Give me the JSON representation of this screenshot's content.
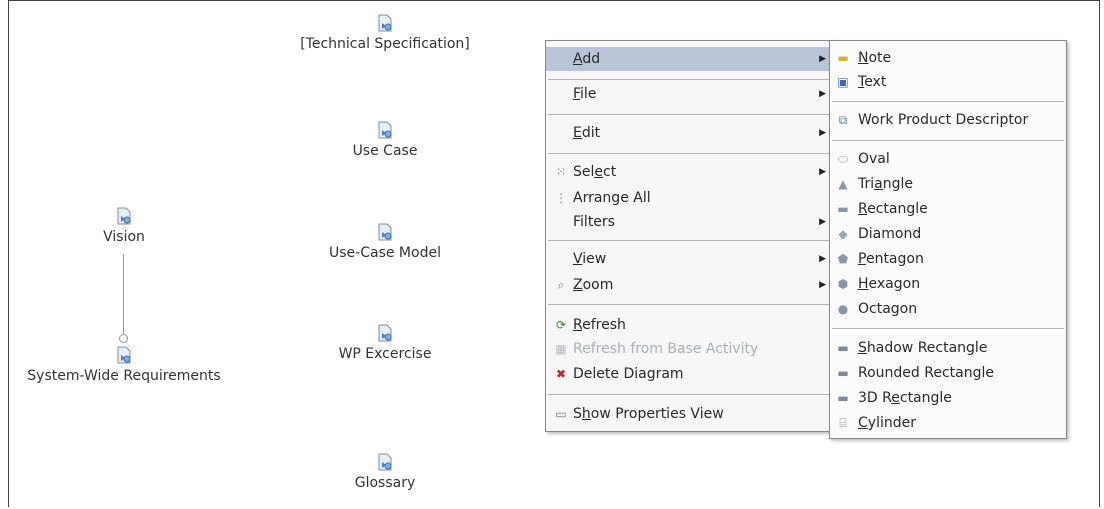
{
  "diagram": {
    "nodes": [
      {
        "id": "technical-spec",
        "label": "[Technical Specification]"
      },
      {
        "id": "use-case",
        "label": "Use Case"
      },
      {
        "id": "use-case-model",
        "label": "Use-Case Model"
      },
      {
        "id": "wp-excercise",
        "label": "WP Excercise"
      },
      {
        "id": "glossary",
        "label": "Glossary"
      },
      {
        "id": "vision",
        "label": "Vision"
      },
      {
        "id": "system-wide",
        "label": "System-Wide Requirements"
      }
    ]
  },
  "context_menu": {
    "items": [
      {
        "label": "Add",
        "mnemonic": "A",
        "rest": "dd",
        "submenu": true,
        "highlighted": true
      },
      {
        "label": "File",
        "mnemonic": "F",
        "rest": "ile",
        "submenu": true
      },
      {
        "label": "Edit",
        "mnemonic": "E",
        "rest": "dit",
        "submenu": true
      },
      {
        "label": "Select",
        "pre": "Sel",
        "mnemonic": "e",
        "rest": "ct",
        "submenu": true,
        "icon": "select-icon"
      },
      {
        "label": "Arrange All",
        "pre": "Arran",
        "mnemonic": "g",
        "rest": "e All",
        "icon": "arrange-icon"
      },
      {
        "label": "Filters",
        "submenu": true
      },
      {
        "label": "View",
        "mnemonic": "V",
        "rest": "iew",
        "submenu": true
      },
      {
        "label": "Zoom",
        "mnemonic": "Z",
        "rest": "oom",
        "submenu": true,
        "icon": "zoom-icon"
      },
      {
        "label": "Refresh",
        "mnemonic": "R",
        "rest": "efresh",
        "icon": "refresh-icon"
      },
      {
        "label": "Refresh from Base Activity",
        "disabled": true,
        "icon": "refresh-base-icon"
      },
      {
        "label": "Delete Diagram",
        "icon": "delete-icon",
        "icon_color": "#cc2222"
      },
      {
        "label": "Show Properties View",
        "pre": "S",
        "mnemonic": "h",
        "rest": "ow Properties View",
        "icon": "properties-icon"
      }
    ]
  },
  "add_submenu": {
    "items": [
      {
        "label": "Note",
        "mnemonic": "N",
        "rest": "ote",
        "icon": "note-icon"
      },
      {
        "label": "Text",
        "mnemonic": "T",
        "rest": "ext",
        "icon": "text-icon"
      },
      {
        "label": "Work Product Descriptor",
        "icon": "work-product-icon"
      },
      {
        "label": "Oval",
        "icon": "oval-icon"
      },
      {
        "label": "Triangle",
        "pre": "Tri",
        "mnemonic": "a",
        "rest": "ngle",
        "icon": "triangle-icon"
      },
      {
        "label": "Rectangle",
        "mnemonic": "R",
        "rest": "ectangle",
        "icon": "rectangle-icon"
      },
      {
        "label": "Diamond",
        "icon": "diamond-icon"
      },
      {
        "label": "Pentagon",
        "mnemonic": "P",
        "rest": "entagon",
        "icon": "pentagon-icon"
      },
      {
        "label": "Hexagon",
        "mnemonic": "H",
        "rest": "exagon",
        "icon": "hexagon-icon"
      },
      {
        "label": "Octagon",
        "icon": "octagon-icon"
      },
      {
        "label": "Shadow Rectangle",
        "mnemonic": "S",
        "rest": "hadow Rectangle",
        "icon": "shadow-rectangle-icon"
      },
      {
        "label": "Rounded Rectangle",
        "icon": "rounded-rectangle-icon"
      },
      {
        "label": "3D Rectangle",
        "pre": "3D R",
        "mnemonic": "e",
        "rest": "ctangle",
        "icon": "3d-rectangle-icon"
      },
      {
        "label": "Cylinder",
        "mnemonic": "C",
        "rest": "ylinder",
        "icon": "cylinder-icon"
      }
    ]
  },
  "colors": {
    "highlight": "#b9c4d8",
    "disabled": "#aab0b8"
  }
}
